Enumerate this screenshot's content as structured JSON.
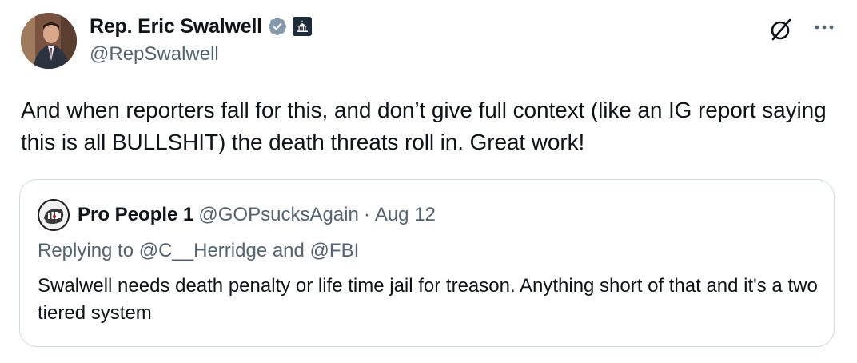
{
  "author": {
    "display_name": "Rep. Eric Swalwell",
    "handle": "@RepSwalwell",
    "verified_icon": "verified-badge-gray-icon",
    "affiliation_icon": "us-capitol-icon"
  },
  "actions": {
    "grok_icon": "grok-slash-circle-icon",
    "more_icon": "more-horizontal-icon"
  },
  "tweet": {
    "text": "And when reporters fall for this, and don’t give full context (like an IG report saying this is all BULLSHIT) the death threats roll in. Great work!"
  },
  "quote": {
    "display_name": "Pro People 1",
    "handle": "@GOPsucksAgain",
    "separator": "·",
    "date": "Aug 12",
    "replying_to": "Replying to @C__Herridge and @FBI",
    "text": "Swalwell needs death penalty or life time jail for treason. Anything short of that and it's a two tiered system"
  },
  "colors": {
    "text_primary": "#0f1419",
    "text_secondary": "#536471",
    "border": "#cfd9de",
    "verified_badge": "#829aab"
  }
}
